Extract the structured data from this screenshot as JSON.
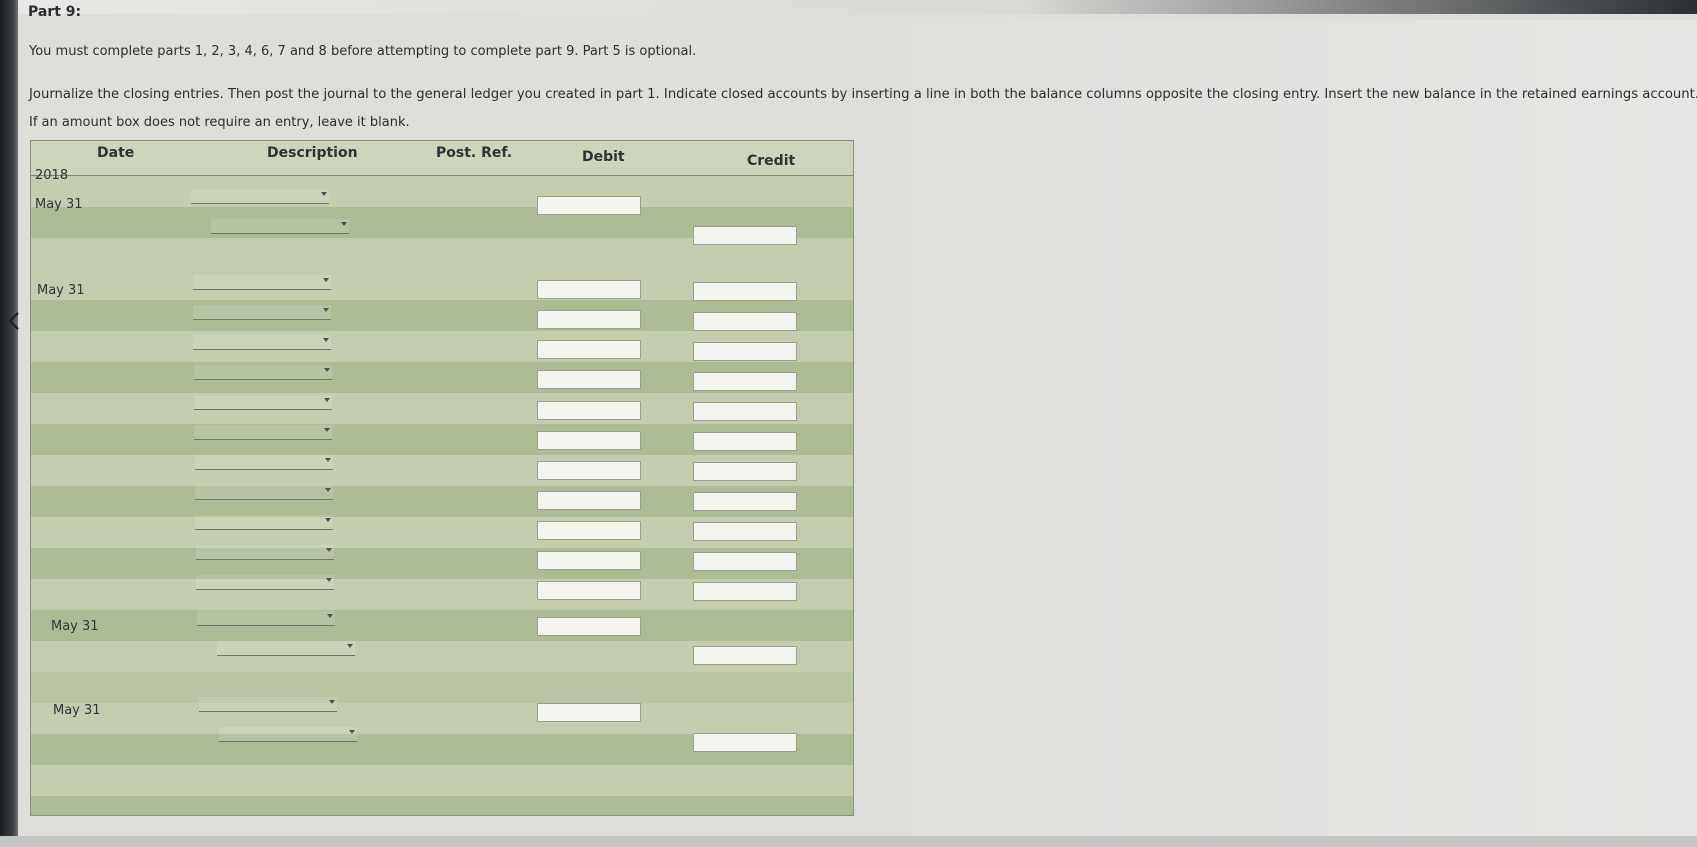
{
  "part": {
    "title": "Part 9:"
  },
  "instructions": {
    "line1": "You must complete parts 1, 2, 3, 4, 6, 7 and 8 before attempting to complete part 9. Part 5 is optional.",
    "line2": "Journalize the closing entries. Then post the journal to the general ledger you created in part 1. Indicate closed accounts by inserting a line in both the balance columns opposite the closing entry. Insert the new balance in the retained earnings account.",
    "line3": "If an amount box does not require an entry, leave it blank."
  },
  "journal": {
    "headers": {
      "date": "Date",
      "description": "Description",
      "post_ref": "Post. Ref.",
      "debit": "Debit",
      "credit": "Credit"
    },
    "year": "2018",
    "entries": [
      {
        "date": "May 31"
      },
      {
        "date": "May 31"
      },
      {
        "date": "May 31"
      },
      {
        "date": "May 31"
      }
    ],
    "description_placeholder": "",
    "amount_placeholder": ""
  },
  "icons": {
    "nav_back": "chevron-left-icon",
    "dropdown": "dropdown-arrow-icon"
  }
}
